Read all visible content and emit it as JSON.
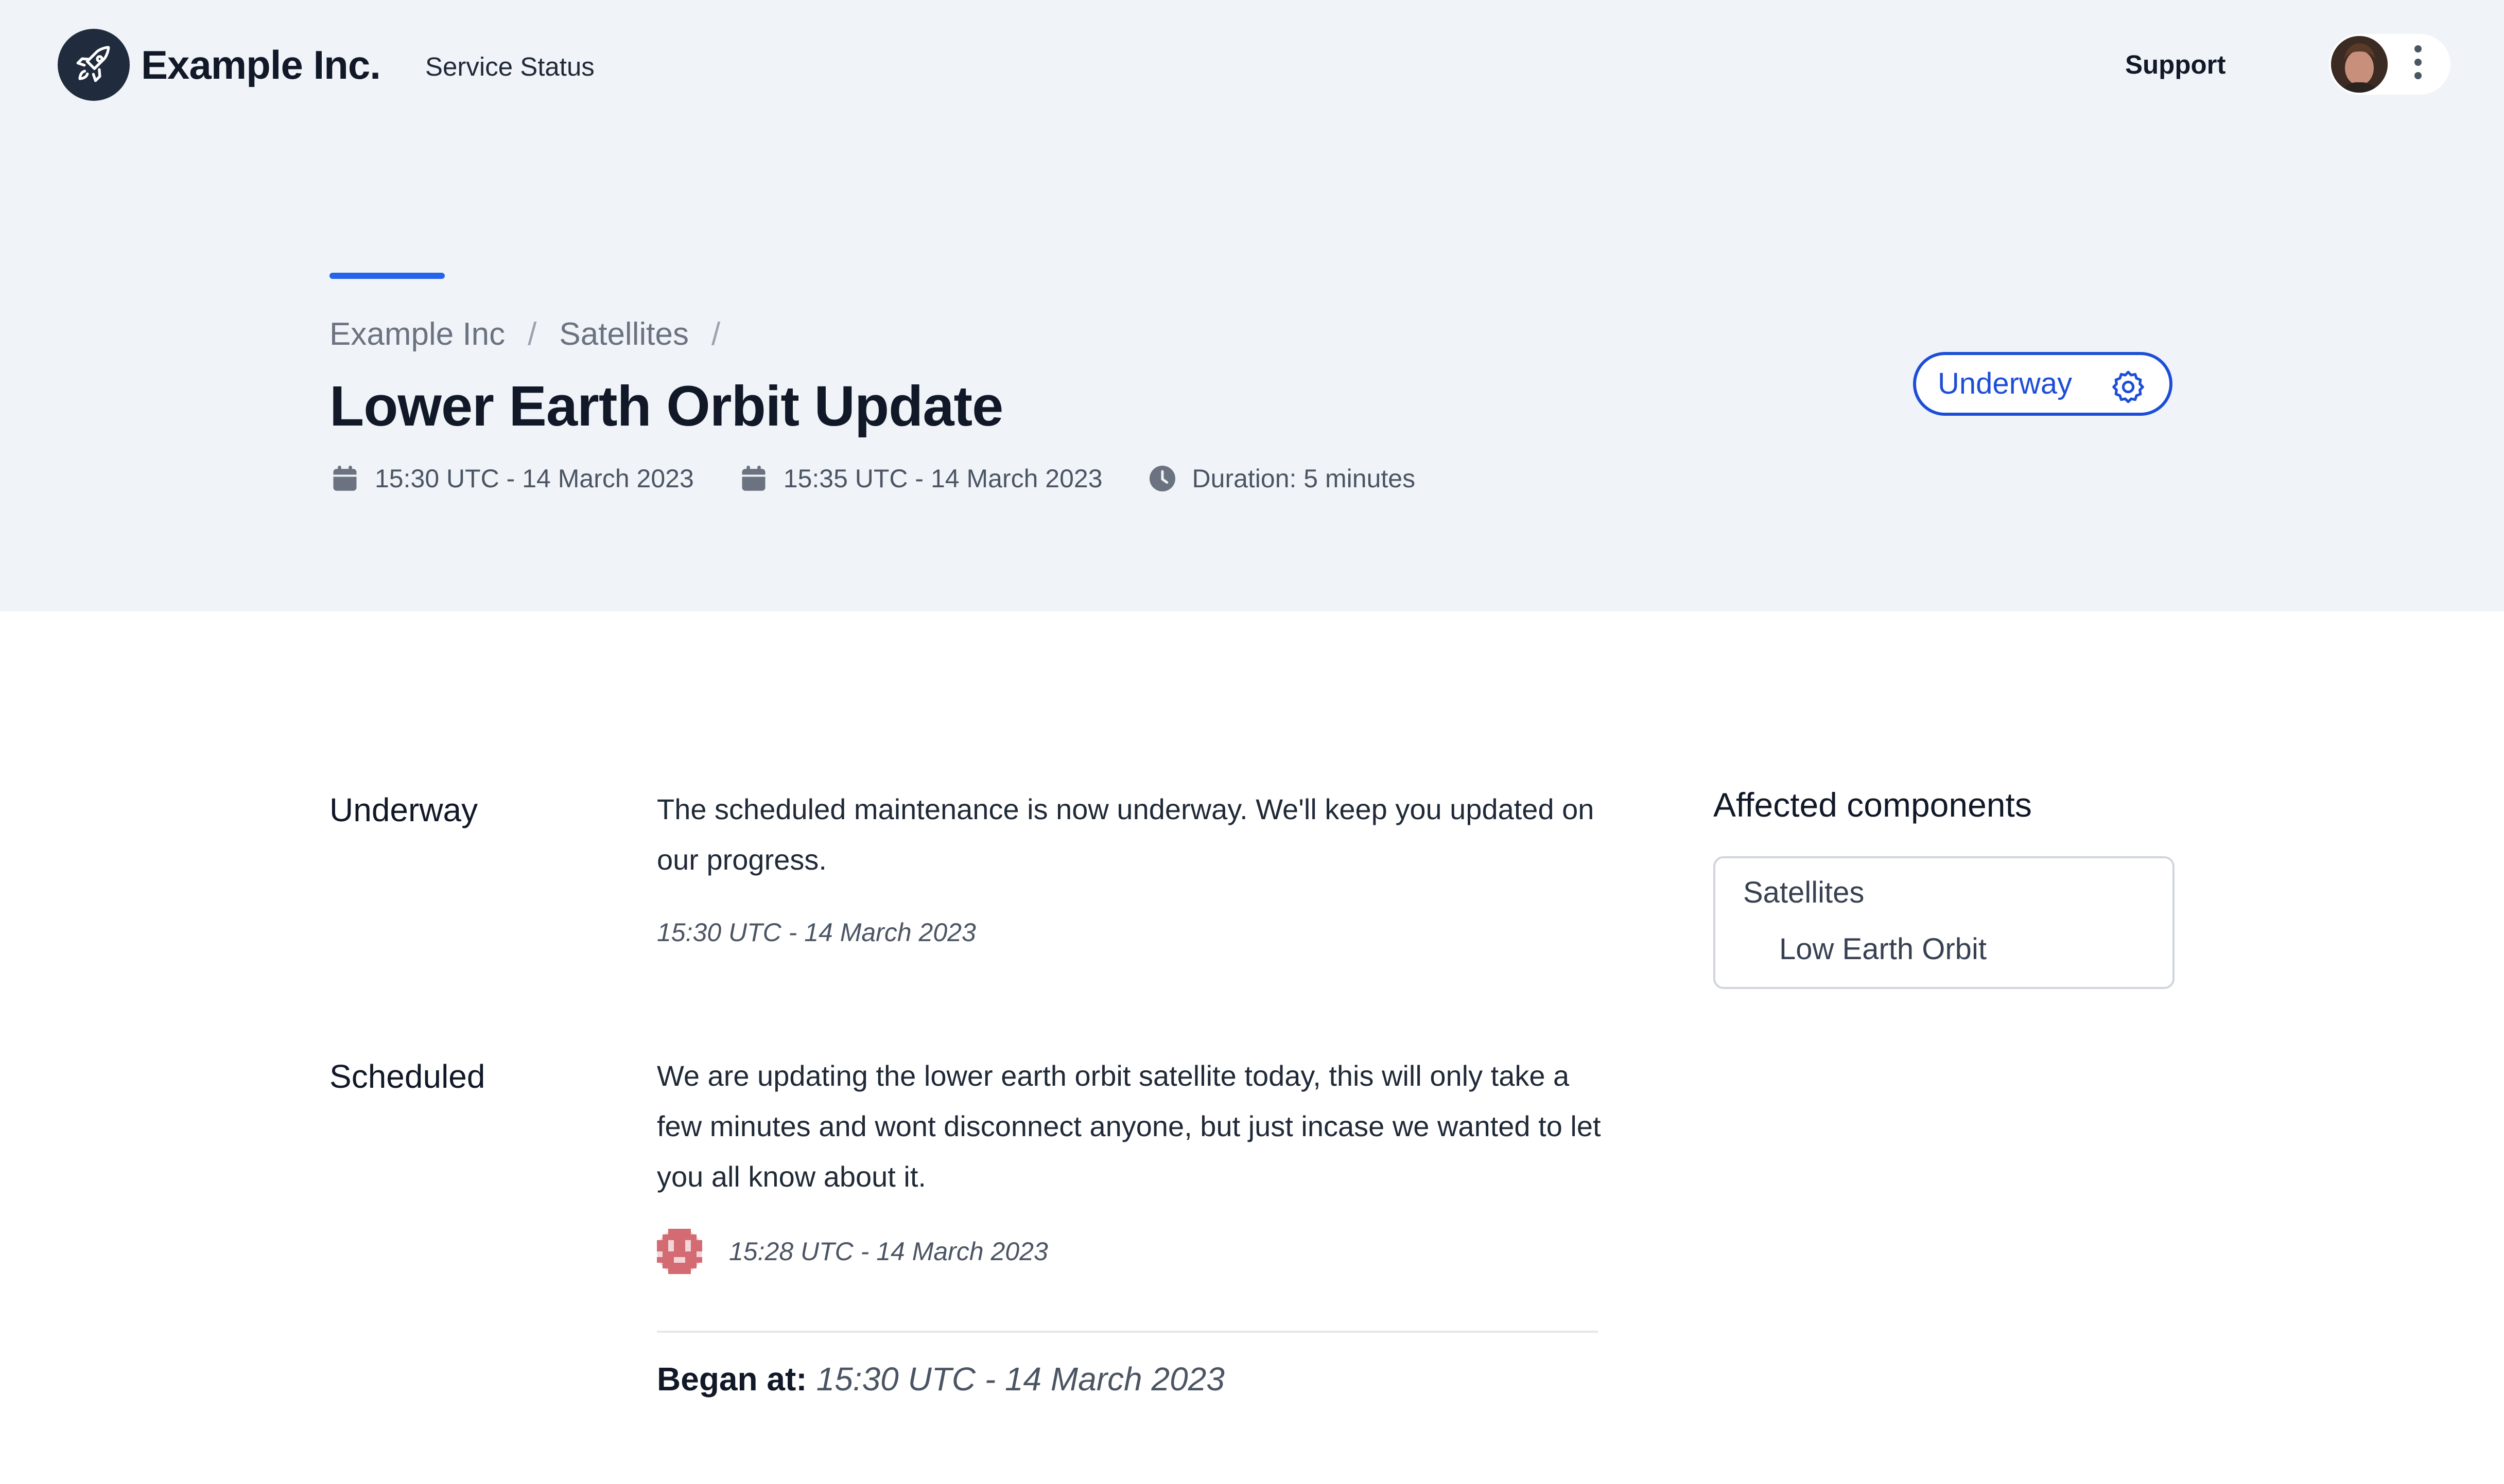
{
  "header": {
    "brand": "Example Inc.",
    "nav_link": "Service Status",
    "support": "Support"
  },
  "hero": {
    "breadcrumb": [
      "Example Inc",
      "Satellites"
    ],
    "breadcrumb_separator": "/",
    "title": "Lower Earth Orbit Update",
    "meta": {
      "start": "15:30 UTC - 14 March 2023",
      "end": "15:35 UTC - 14 March 2023",
      "duration": "Duration: 5 minutes"
    },
    "status_button": "Underway"
  },
  "updates": [
    {
      "status": "Underway",
      "text": "The scheduled maintenance is now underway. We'll keep you updated on our progress.",
      "time": "15:30 UTC - 14 March 2023"
    },
    {
      "status": "Scheduled",
      "text": "We are updating the lower earth orbit satellite today, this will only take a few minutes and wont disconnect anyone, but just incase we wanted to let you all know about it.",
      "time": "15:28 UTC - 14 March 2023"
    }
  ],
  "began": {
    "label": "Began at:",
    "value": "15:30 UTC - 14 March 2023"
  },
  "affected": {
    "title": "Affected components",
    "group": "Satellites",
    "child": "Low Earth Orbit"
  },
  "icons": {
    "logo": "rocket-icon",
    "start": "calendar-icon",
    "end": "calendar-icon",
    "duration": "clock-icon",
    "status": "gear-icon",
    "menu": "kebab-menu-icon"
  },
  "colors": {
    "accent": "#2563eb",
    "status_blue": "#1d4ed8",
    "hero_bg": "#f0f3f8",
    "logo_bg": "#202b3d",
    "author_avatar": "#d46a72"
  }
}
